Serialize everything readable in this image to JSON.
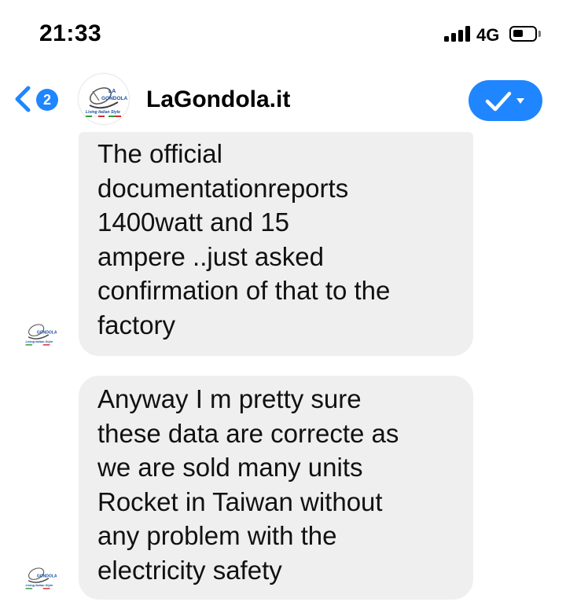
{
  "status_bar": {
    "time": "21:33",
    "network": "4G",
    "signal_bars": 4,
    "battery_level": 0.45
  },
  "header": {
    "unread_count": "2",
    "contact_name": "LaGondola.it",
    "back_icon": "chevron-left-icon",
    "action_icon": "checkmark-dropdown-icon",
    "accent_color": "#1f86ff"
  },
  "logo": {
    "brand_top": "LA",
    "brand_name": "GONDOLA",
    "tagline": "Living Italian Style"
  },
  "messages": [
    {
      "sender": "LaGondola.it",
      "lines": [
        "The official",
        "documentationreports",
        "1400watt and 15",
        "ampere ..just asked",
        "confirmation of that to the",
        "factory"
      ]
    },
    {
      "sender": "LaGondola.it",
      "lines": [
        "Anyway I m pretty sure",
        "these data are correcte as",
        "we are sold many units",
        "Rocket in Taiwan without",
        "any problem with the",
        "electricity safety"
      ]
    }
  ]
}
